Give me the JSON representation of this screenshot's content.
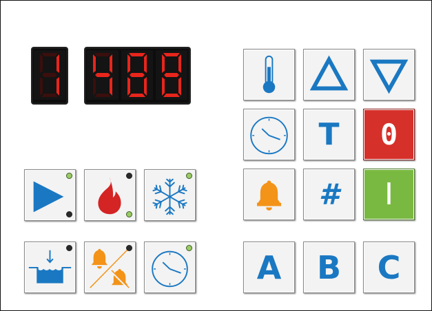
{
  "display": {
    "channel": "1",
    "value": "4884",
    "segment_on_color": "#e8251c",
    "segment_off_color": "#3a0f0d"
  },
  "keys": {
    "thermometer": {
      "icon": "thermometer-icon"
    },
    "up": {
      "icon": "triangle-up-icon"
    },
    "down": {
      "icon": "triangle-down-icon"
    },
    "clock": {
      "icon": "clock-icon"
    },
    "t": {
      "label": "T"
    },
    "off": {
      "label": "0"
    },
    "bell": {
      "icon": "bell-icon"
    },
    "hash": {
      "label": "#"
    },
    "on": {
      "label": "I"
    },
    "play": {
      "icon": "play-icon",
      "led_top": "on",
      "led_bottom": "off"
    },
    "flame": {
      "icon": "flame-icon",
      "led_top": "off",
      "led_bottom": "on"
    },
    "snowflake": {
      "icon": "snowflake-icon",
      "led_top": "on"
    },
    "fill": {
      "icon": "water-fill-icon",
      "led_top": "off"
    },
    "alarm_mute": {
      "icon": "alarm-mute-icon",
      "led_top": "off"
    },
    "timer": {
      "icon": "clock-icon",
      "led_top": "on"
    },
    "a": {
      "label": "A"
    },
    "b": {
      "label": "B"
    },
    "c": {
      "label": "C"
    }
  },
  "colors": {
    "icon_blue": "#1a78c2",
    "flame_red": "#d42424",
    "bell_orange": "#f39318",
    "off_red": "#d6302a",
    "on_green": "#79b941",
    "led_green": "#9acb64",
    "led_off": "#2a2a2a"
  }
}
